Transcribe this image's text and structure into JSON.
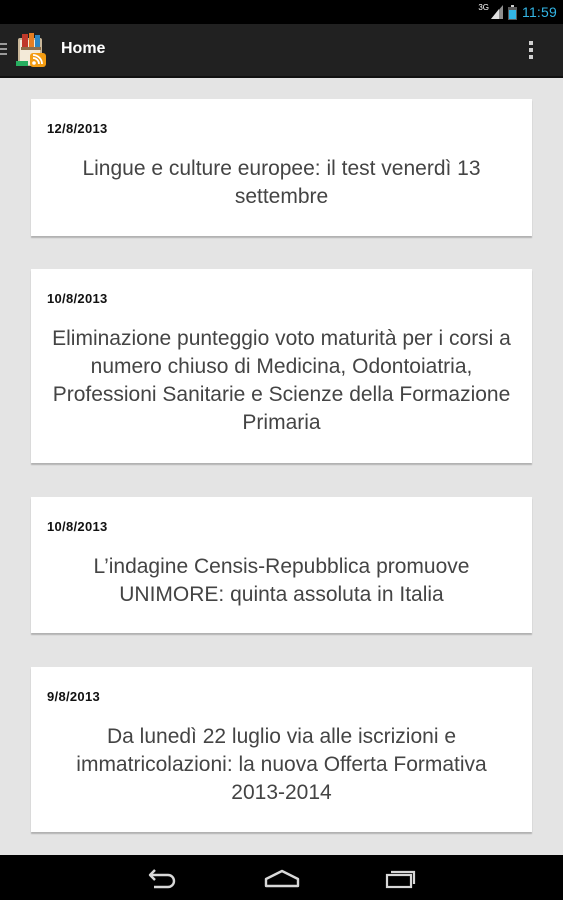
{
  "status_bar": {
    "network": "3G",
    "time": "11:59",
    "clock_color": "#33b5e5"
  },
  "action_bar": {
    "title": "Home",
    "logo_icon": "books-rss-icon",
    "menu_icon": "overflow-menu-icon"
  },
  "news": [
    {
      "date": "12/8/2013",
      "title": "Lingue e culture europee: il test venerdì 13 settembre"
    },
    {
      "date": "10/8/2013",
      "title": "Eliminazione punteggio voto maturità per i corsi a numero chiuso di Medicina, Odontoiatria, Professioni Sanitarie e Scienze della Formazione Primaria"
    },
    {
      "date": "10/8/2013",
      "title": "L’indagine Censis-Repubblica promuove UNIMORE: quinta assoluta in Italia"
    },
    {
      "date": "9/8/2013",
      "title": "Da lunedì 22 luglio via alle iscrizioni e immatricolazioni: la nuova Offerta Formativa 2013-2014"
    }
  ],
  "nav_bar": {
    "back_icon": "back-icon",
    "home_icon": "home-icon",
    "recents_icon": "recent-apps-icon"
  }
}
